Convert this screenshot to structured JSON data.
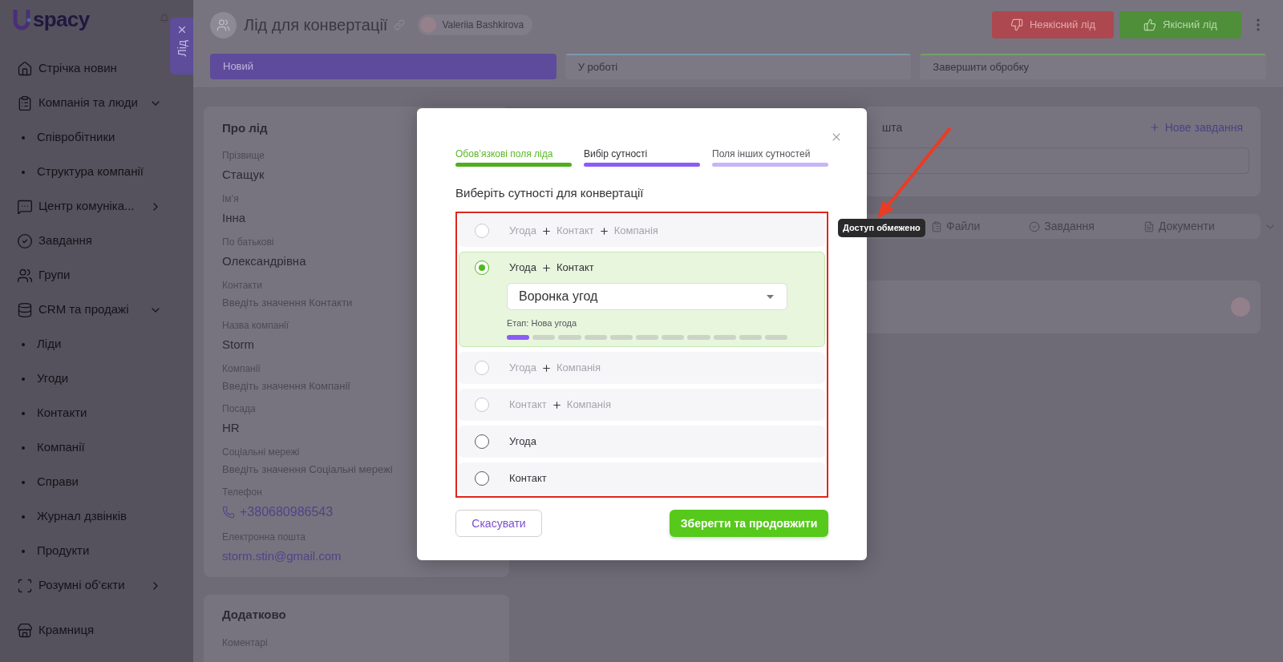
{
  "sidebar": {
    "logo": "spacy",
    "items": [
      {
        "label": "Стрічка новин"
      },
      {
        "label": "Компанія та люди",
        "expanded": true,
        "children": [
          {
            "label": "Співробітники"
          },
          {
            "label": "Структура компанії"
          }
        ]
      },
      {
        "label": "Центр комуніка...",
        "expanded": false
      },
      {
        "label": "Завдання"
      },
      {
        "label": "Групи"
      },
      {
        "label": "CRM та продажі",
        "expanded": true,
        "children": [
          {
            "label": "Ліди"
          },
          {
            "label": "Угоди"
          },
          {
            "label": "Контакти"
          },
          {
            "label": "Компанії"
          },
          {
            "label": "Справи"
          },
          {
            "label": "Журнал дзвінків"
          },
          {
            "label": "Продукти"
          }
        ]
      },
      {
        "label": "Розумні об’єкти",
        "expanded": false
      },
      {
        "label": "Крамниця"
      }
    ]
  },
  "side_tab": {
    "label": "Лід"
  },
  "header": {
    "title": "Лід для конвертації",
    "user": "Valeriia Bashkirova",
    "actions": [
      {
        "label": "Неякісний лід",
        "kind": "reject"
      },
      {
        "label": "Якісний лід",
        "kind": "approve"
      }
    ]
  },
  "stages": [
    {
      "label": "Новий",
      "selected": true,
      "color": "#5e4b9b"
    },
    {
      "label": "У роботі",
      "selected": false,
      "color": "#7d97ae"
    },
    {
      "label": "Завершити обробку",
      "selected": false,
      "color": "#74a267"
    }
  ],
  "lead_card": {
    "title": "Про лід",
    "fields": [
      {
        "label": "Прізвище",
        "kind": "text",
        "value": "Стащук"
      },
      {
        "label": "Ім’я",
        "kind": "text",
        "value": "Інна"
      },
      {
        "label": "По батькові",
        "kind": "text",
        "value": "Олександрівна"
      },
      {
        "label": "Контакти",
        "kind": "empty",
        "placeholder": "Введіть значення Контакти"
      },
      {
        "label": "Назва компанії",
        "kind": "text",
        "value": "Storm"
      },
      {
        "label": "Компанії",
        "kind": "empty",
        "placeholder": "Введіть значення Компанії"
      },
      {
        "label": "Посада",
        "kind": "text",
        "value": "HR"
      },
      {
        "label": "Соціальні мережі",
        "kind": "empty",
        "placeholder": "Введіть значення Соціальні мережі"
      },
      {
        "label": "Телефон",
        "kind": "phone",
        "value": "+380680986543"
      },
      {
        "label": "Електронна пошта",
        "kind": "email",
        "value": "storm.stin@gmail.com"
      }
    ]
  },
  "extra_card": {
    "title": "Додатково",
    "fields": [
      {
        "label": "Коментарі"
      }
    ]
  },
  "activity_card": {
    "title": "шта",
    "new_task": "Нове завдання"
  },
  "tabs": [
    {
      "label": "Файли"
    },
    {
      "label": "Завдання"
    },
    {
      "label": "Документи"
    }
  ],
  "modal": {
    "steps": [
      {
        "label": "Обов’язкові поля ліда",
        "completed": true,
        "selected": false
      },
      {
        "label": "Вибір сутності",
        "completed": false,
        "selected": true
      },
      {
        "label": "Поля інших сутностей",
        "completed": false,
        "selected": false
      }
    ],
    "heading": "Виберіть сутності для конвертації",
    "options": [
      {
        "parts": [
          "Угода",
          "Контакт",
          "Компанія"
        ],
        "disabled": true,
        "selected": false
      },
      {
        "parts": [
          "Угода",
          "Контакт"
        ],
        "disabled": false,
        "selected": true,
        "pipeline": {
          "value": "Воронка угод",
          "stage": "Етап: Нова угода",
          "segments": [
            {
              "reached": true
            },
            {
              "reached": false
            },
            {
              "reached": false
            },
            {
              "reached": false
            },
            {
              "reached": false
            },
            {
              "reached": false
            },
            {
              "reached": false
            },
            {
              "reached": false
            },
            {
              "reached": false
            },
            {
              "reached": false
            },
            {
              "reached": false
            }
          ]
        }
      },
      {
        "parts": [
          "Угода",
          "Компанія"
        ],
        "disabled": true,
        "selected": false
      },
      {
        "parts": [
          "Контакт",
          "Компанія"
        ],
        "disabled": true,
        "selected": false
      },
      {
        "parts": [
          "Угода"
        ],
        "disabled": false,
        "selected": false
      },
      {
        "parts": [
          "Контакт"
        ],
        "disabled": false,
        "selected": false
      }
    ],
    "cancel": "Скасувати",
    "confirm": "Зберегти та продовжити"
  },
  "tooltip": {
    "text": "Доступ обмежено"
  }
}
